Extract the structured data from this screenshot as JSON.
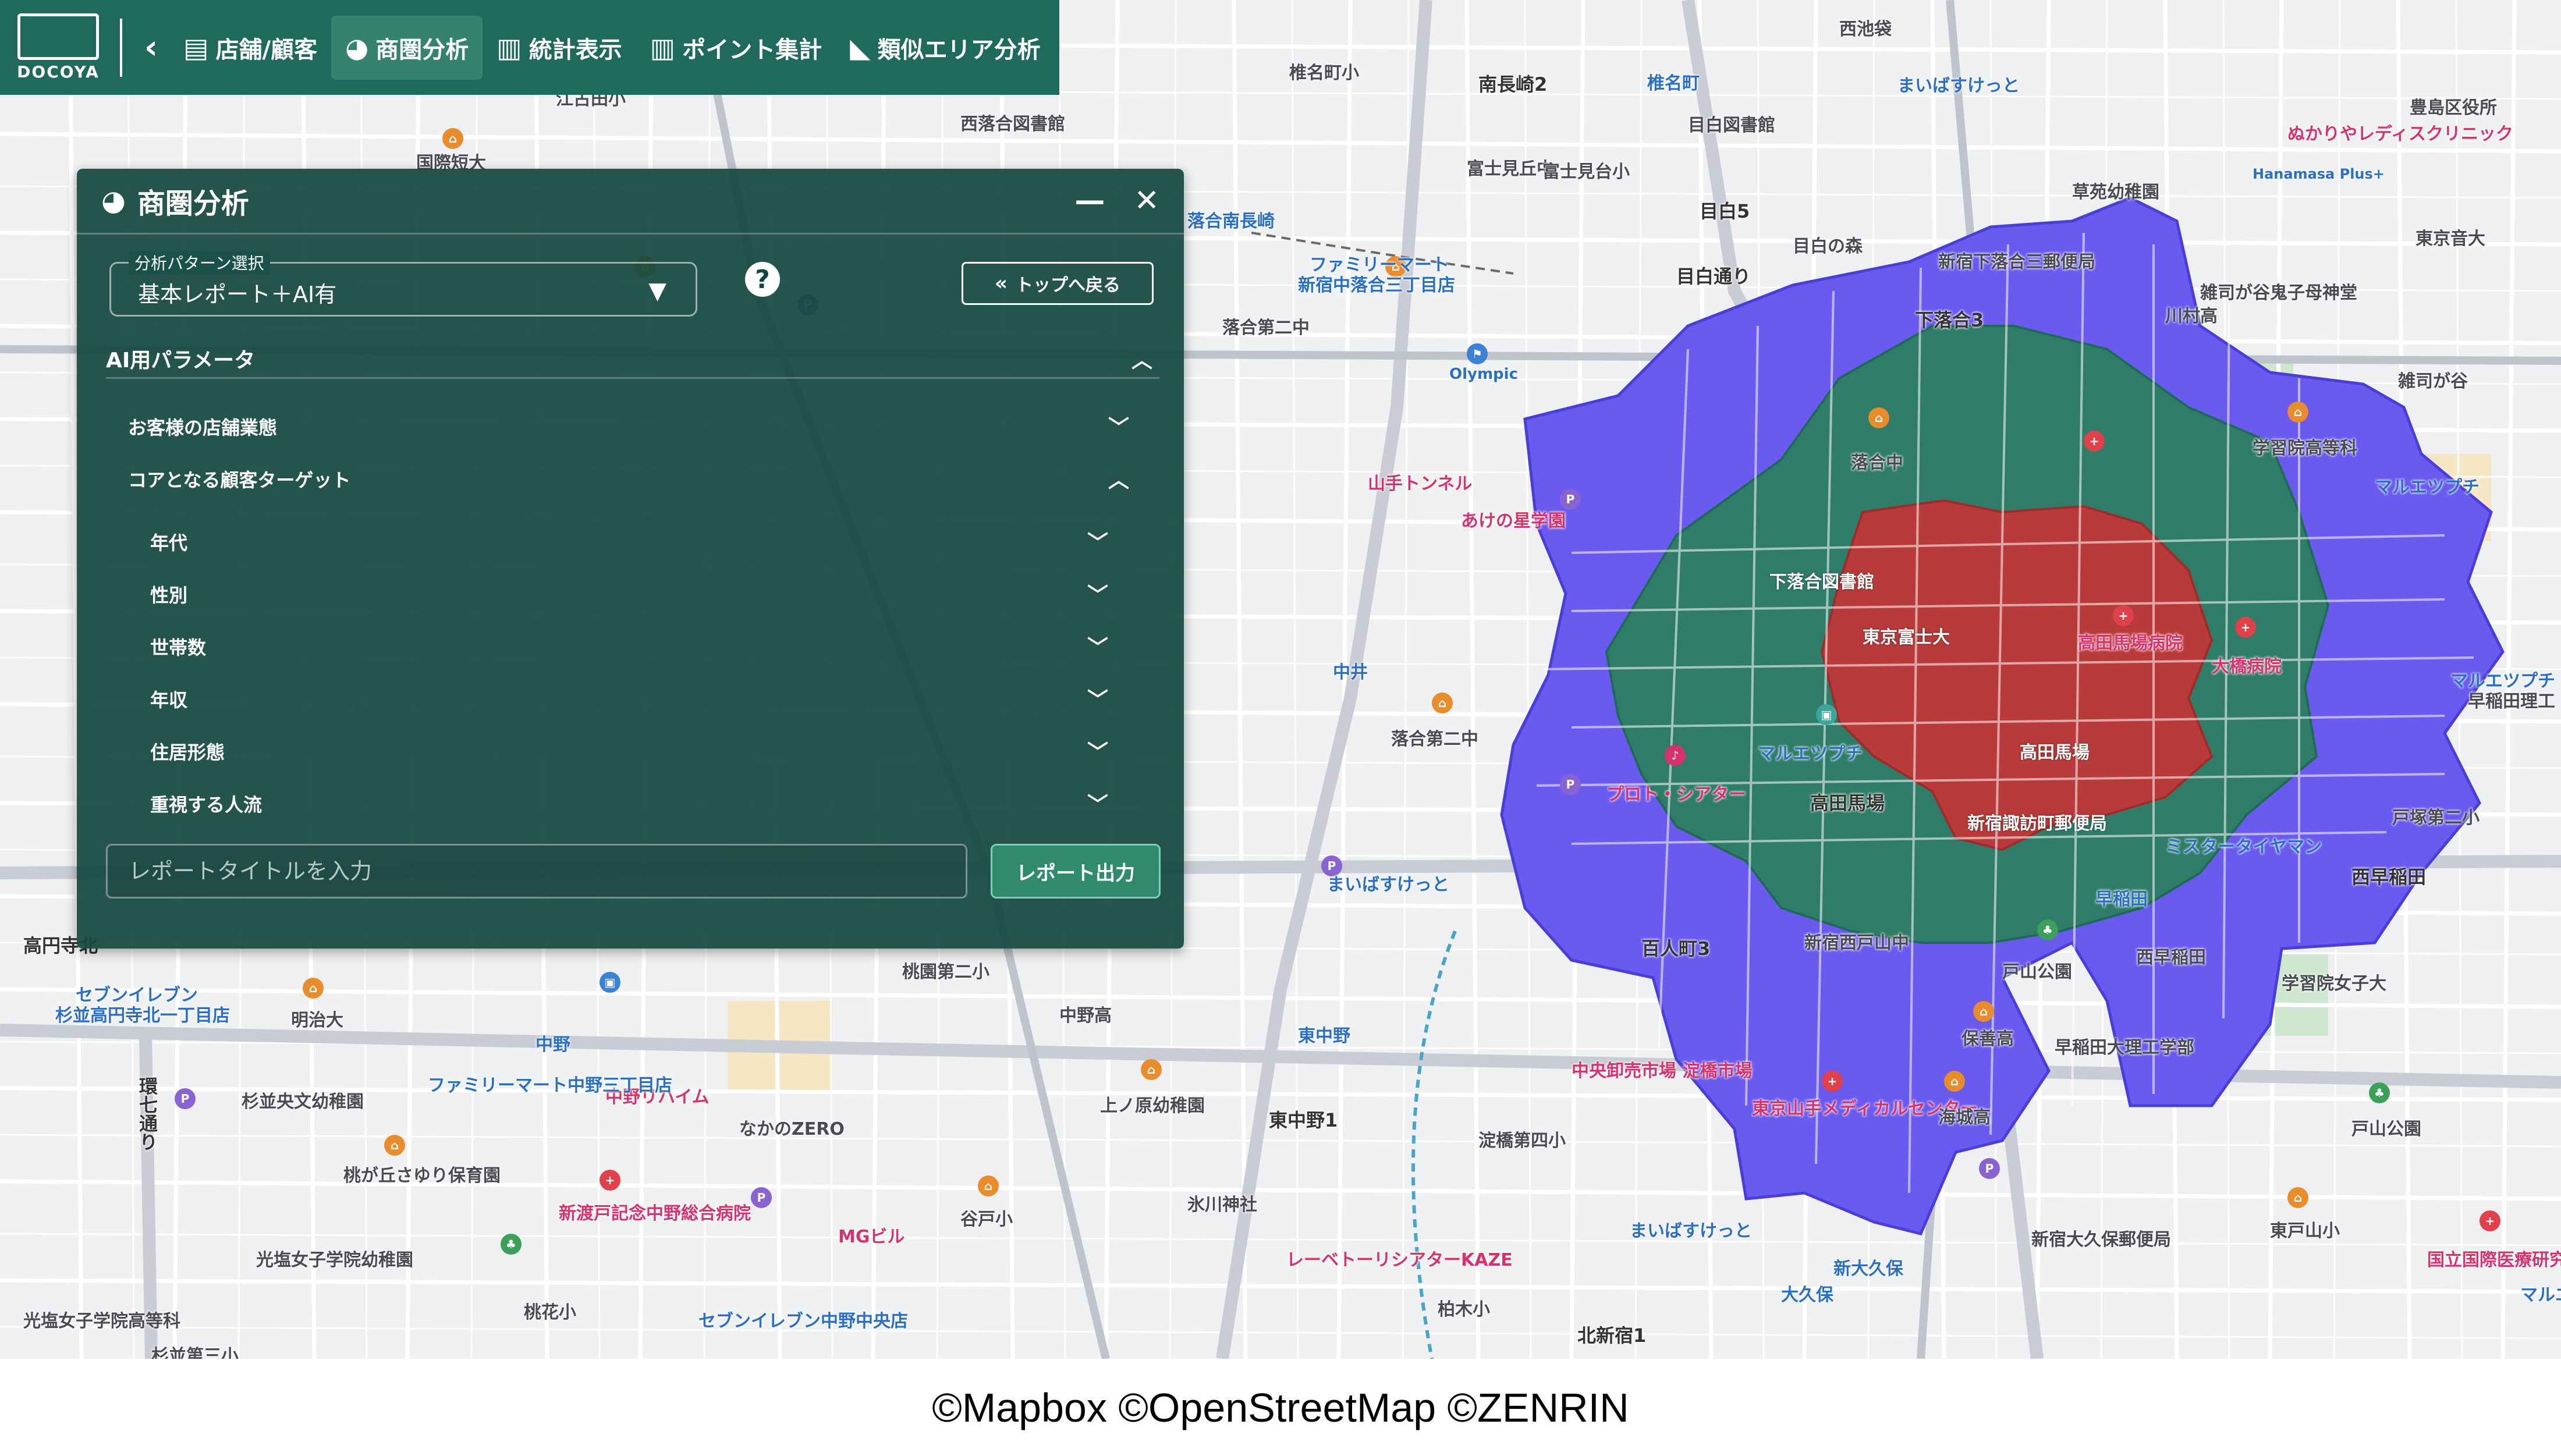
{
  "toolbar": {
    "logo_text": "DOCOYA",
    "items": [
      {
        "label": "店舗/顧客",
        "icon": "store-icon"
      },
      {
        "label": "商圏分析",
        "icon": "pie-chart-icon"
      },
      {
        "label": "統計表示",
        "icon": "bar-chart-icon"
      },
      {
        "label": "ポイント集計",
        "icon": "bar-chart-icon"
      },
      {
        "label": "類似エリア分析",
        "icon": "area-chart-icon"
      }
    ]
  },
  "panel": {
    "title": "商圏分析",
    "pattern_label": "分析パターン選択",
    "pattern_value": "基本レポート＋AI有",
    "help": "?",
    "back_to_top": "トップへ戻る",
    "ai_section": "AI用パラメータ",
    "param_store_type": "お客様の店舗業態",
    "param_core_target": "コアとなる顧客ターゲット",
    "sub_params": [
      "年代",
      "性別",
      "世帯数",
      "年収",
      "住居形態",
      "重視する人流"
    ],
    "title_placeholder": "レポートタイトルを入力",
    "report_button": "レポート出力"
  },
  "map": {
    "labels": [
      {
        "t": "南長崎2",
        "c": "dark"
      },
      {
        "t": "椎名町",
        "c": "blue"
      },
      {
        "t": "まいばすけっと",
        "c": "blue"
      },
      {
        "t": "目白5",
        "c": "dark"
      },
      {
        "t": "目白通り",
        "c": "dark"
      },
      {
        "t": "下落合3",
        "c": "dark"
      },
      {
        "t": "ファミリーマート",
        "c": "blue"
      },
      {
        "t": "新宿中落合三丁目店",
        "c": "blue"
      },
      {
        "t": "落合第二中",
        "c": ""
      },
      {
        "t": "Olympic",
        "c": "blue"
      },
      {
        "t": "山手トンネル",
        "c": "pink"
      },
      {
        "t": "あけの星学園",
        "c": "pink"
      },
      {
        "t": "落合中",
        "c": ""
      },
      {
        "t": "富士見丘中",
        "c": ""
      },
      {
        "t": "目白の森",
        "c": ""
      },
      {
        "t": "新宿下落合三郵便局",
        "c": ""
      },
      {
        "t": "川村高",
        "c": ""
      },
      {
        "t": "学習院高等科",
        "c": ""
      },
      {
        "t": "マルエツプチ",
        "c": "blue"
      },
      {
        "t": "雑司が谷",
        "c": ""
      },
      {
        "t": "中井",
        "c": "blue"
      },
      {
        "t": "下落合図書館",
        "c": ""
      },
      {
        "t": "東京富士大",
        "c": ""
      },
      {
        "t": "高田馬場病院",
        "c": "pink"
      },
      {
        "t": "大橋病院",
        "c": "pink"
      },
      {
        "t": "戸塚第二小",
        "c": ""
      },
      {
        "t": "落合第二中",
        "c": ""
      },
      {
        "t": "高田馬場",
        "c": "dark"
      },
      {
        "t": "高田馬場",
        "c": "white"
      },
      {
        "t": "プロト・シアター",
        "c": "pink"
      },
      {
        "t": "マルエツプチ",
        "c": "blue"
      },
      {
        "t": "新宿諏訪町郵便局",
        "c": ""
      },
      {
        "t": "ミスタータイヤマン",
        "c": "blue"
      },
      {
        "t": "西早稲田",
        "c": "dark"
      },
      {
        "t": "まいばすけっと",
        "c": "blue"
      },
      {
        "t": "百人町3",
        "c": "dark"
      },
      {
        "t": "新宿西戸山中",
        "c": ""
      },
      {
        "t": "戸山公園",
        "c": ""
      },
      {
        "t": "西早稲田",
        "c": ""
      },
      {
        "t": "学習院女子大",
        "c": ""
      },
      {
        "t": "早稲田大理工学部",
        "c": ""
      },
      {
        "t": "保善高",
        "c": ""
      },
      {
        "t": "中央卸売市場 淀橋市場",
        "c": "pink"
      },
      {
        "t": "東京山手メディカルセンター",
        "c": "pink"
      },
      {
        "t": "海城高",
        "c": ""
      },
      {
        "t": "戸山公園",
        "c": ""
      },
      {
        "t": "新宿大久保郵便局",
        "c": ""
      },
      {
        "t": "東戸山小",
        "c": ""
      },
      {
        "t": "国立国際医療研究センター病院",
        "c": "pink"
      },
      {
        "t": "大久保",
        "c": "blue"
      },
      {
        "t": "新大久保",
        "c": "blue"
      },
      {
        "t": "淀橋第四小",
        "c": ""
      },
      {
        "t": "東中野1",
        "c": "dark"
      },
      {
        "t": "東中野",
        "c": "blue"
      },
      {
        "t": "氷川神社",
        "c": ""
      },
      {
        "t": "レーベトーリシアターKAZE",
        "c": "pink"
      },
      {
        "t": "柏木小",
        "c": ""
      },
      {
        "t": "北新宿1",
        "c": "dark"
      },
      {
        "t": "まいばすけっと",
        "c": "blue"
      },
      {
        "t": "上ノ原幼稚園",
        "c": ""
      },
      {
        "t": "中野高",
        "c": ""
      },
      {
        "t": "谷戸小",
        "c": ""
      },
      {
        "t": "桃園第二小",
        "c": ""
      },
      {
        "t": "MGビル",
        "c": "pink"
      },
      {
        "t": "新渡戸記念中野総合病院",
        "c": "pink"
      },
      {
        "t": "なかのZERO",
        "c": ""
      },
      {
        "t": "中野リハイム",
        "c": "pink"
      },
      {
        "t": "ファミリーマート中野三丁目店",
        "c": "blue"
      },
      {
        "t": "中野",
        "c": "blue"
      },
      {
        "t": "杉並高円寺北一丁目店",
        "c": "blue"
      },
      {
        "t": "セブンイレブン",
        "c": "blue"
      },
      {
        "t": "明治大",
        "c": ""
      },
      {
        "t": "高円寺北",
        "c": "dark"
      },
      {
        "t": "杉並央文幼稚園",
        "c": ""
      },
      {
        "t": "環七通り",
        "c": "dark"
      },
      {
        "t": "桃が丘さゆり保育園",
        "c": ""
      },
      {
        "t": "光塩女子学院幼稚園",
        "c": ""
      },
      {
        "t": "光塩女子学院高等科",
        "c": ""
      },
      {
        "t": "杉並第三小",
        "c": ""
      },
      {
        "t": "桃花小",
        "c": ""
      },
      {
        "t": "セブンイレブン中野中央店",
        "c": "blue"
      },
      {
        "t": "西落合図書館",
        "c": ""
      },
      {
        "t": "国際短大",
        "c": ""
      },
      {
        "t": "江古田小",
        "c": ""
      },
      {
        "t": "落合南長崎",
        "c": "blue"
      },
      {
        "t": "椎名町小",
        "c": ""
      },
      {
        "t": "目白図書館",
        "c": ""
      },
      {
        "t": "富士見台小",
        "c": ""
      },
      {
        "t": "西池袋",
        "c": ""
      },
      {
        "t": "ぬかりやレディスクリニック",
        "c": "pink"
      },
      {
        "t": "Hanamasa Plus+",
        "c": "blue"
      },
      {
        "t": "豊島区役所",
        "c": ""
      },
      {
        "t": "草苑幼稚園",
        "c": ""
      },
      {
        "t": "東京音大",
        "c": ""
      },
      {
        "t": "雑司が谷鬼子母神堂",
        "c": ""
      },
      {
        "t": "マルエツプチ",
        "c": "blue"
      },
      {
        "t": "早稲田理工",
        "c": ""
      },
      {
        "t": "マルエツ",
        "c": "blue"
      },
      {
        "t": "早稲田",
        "c": "blue"
      }
    ]
  },
  "copyright": "©Mapbox ©OpenStreetMap ©ZENRIN"
}
